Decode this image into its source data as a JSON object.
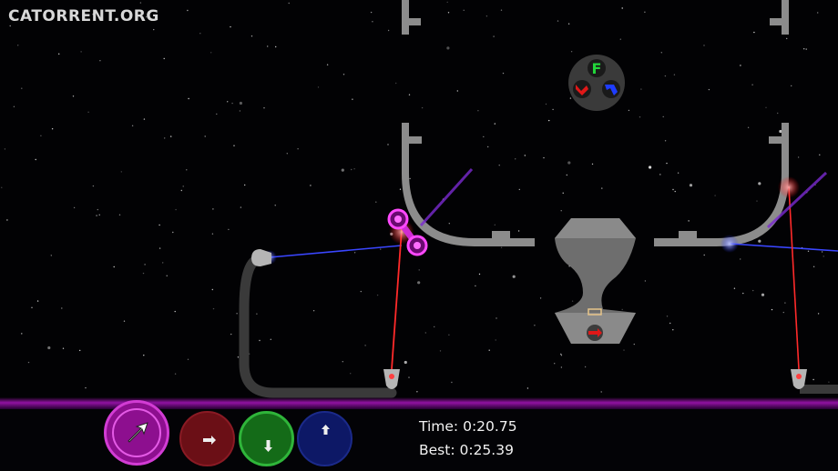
{
  "watermark": "CATORRENT.ORG",
  "hud": {
    "time_label": "Time:",
    "time_value": "0:20.75",
    "best_label": "Best:",
    "best_value": "0:25.39"
  },
  "selector": {
    "top_letter": "F",
    "top_color": "#22d63a",
    "left_color": "#e01818",
    "right_color": "#1e3cff"
  },
  "buttons": [
    {
      "name": "main-arrow-button",
      "color": "#8d0f8f",
      "icon": "arrow-up-right-icon"
    },
    {
      "name": "red-button",
      "color": "#6b0f16",
      "icon": "arrow-right-icon"
    },
    {
      "name": "green-button",
      "color": "#146b18",
      "icon": "arrow-down-icon"
    },
    {
      "name": "blue-button",
      "color": "#0d1866",
      "icon": "arrow-up-icon"
    }
  ],
  "colors": {
    "laser_red": "#ff2a2a",
    "laser_blue": "#3a46ff",
    "pipe_gray": "#8c8c8c",
    "magenta": "#d02cd4"
  }
}
